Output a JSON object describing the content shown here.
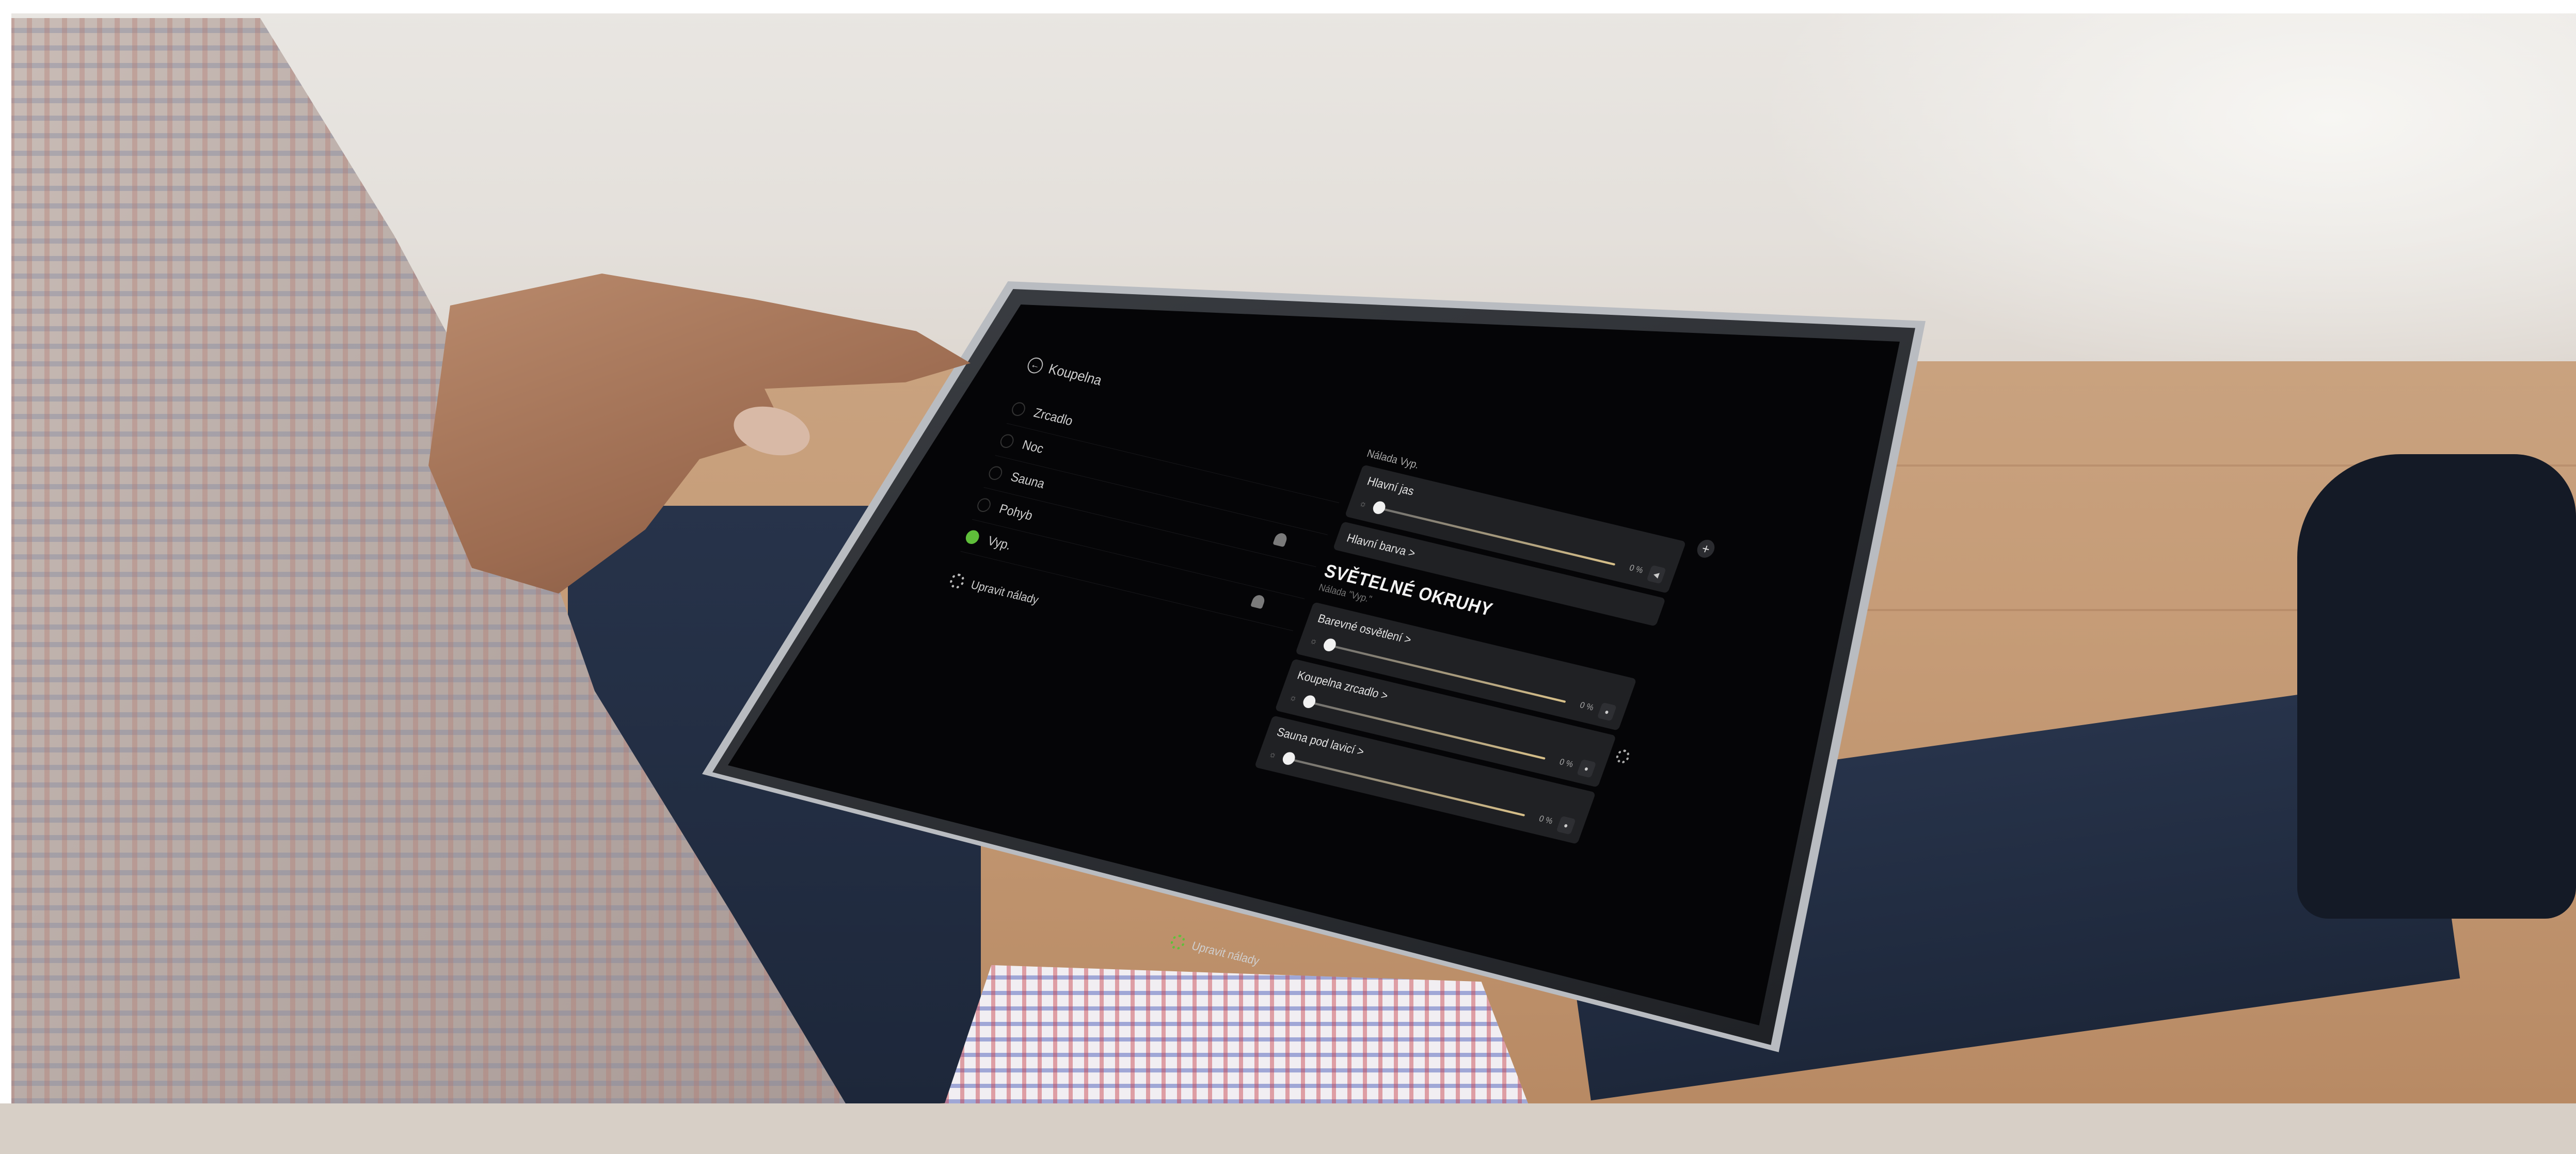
{
  "app": {
    "back_label": "Koupelna"
  },
  "moods": {
    "items": [
      {
        "label": "Zrcadlo",
        "selected": false
      },
      {
        "label": "Noc",
        "selected": false
      },
      {
        "label": "Sauna",
        "selected": false
      },
      {
        "label": "Pohyb",
        "selected": false
      },
      {
        "label": "Vyp.",
        "selected": true
      }
    ],
    "edit_label": "Upravit nálady"
  },
  "main_panel": {
    "mood_title": "Nálada Vyp.",
    "brightness": {
      "title": "Hlavní jas",
      "value_text": "0 %",
      "value": 0
    },
    "color": {
      "title": "Hlavní barva >"
    }
  },
  "circuits": {
    "heading": "SVĚTELNÉ OKRUHY",
    "subheading": "Nálada \"Vyp.\"",
    "items": [
      {
        "title": "Barevné osvětlení >",
        "value_text": "0 %",
        "value": 0
      },
      {
        "title": "Koupelna zrcadlo >",
        "value_text": "0 %",
        "value": 0
      },
      {
        "title": "Sauna pod lavicí >",
        "value_text": "0 %",
        "value": 0
      }
    ],
    "edit_label": "Upravit nálady"
  },
  "icons": {
    "back": "back-arrow-icon",
    "gear": "gear-icon",
    "plus": "plus-icon",
    "user": "user-icon",
    "sun": "sun-icon",
    "chevron": "chevron-right-icon"
  },
  "colors": {
    "accent_green": "#5fbf3a",
    "screen_bg": "#050507",
    "card_bg": "#202124"
  }
}
